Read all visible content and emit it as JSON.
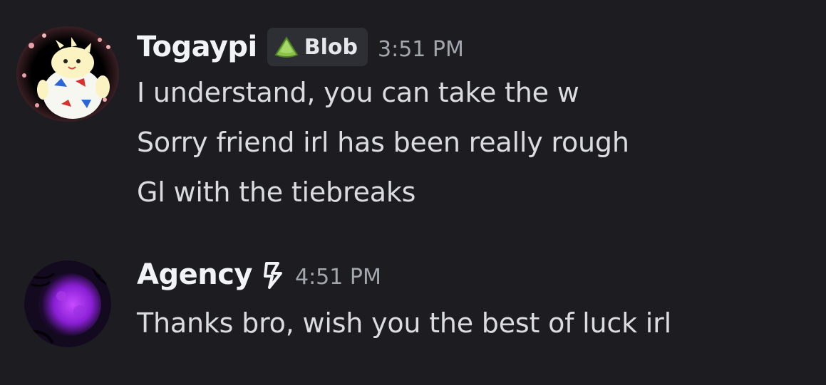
{
  "messages": [
    {
      "author": "Togaypi",
      "role_tag": {
        "label": "Blob",
        "icon": "green-slime-icon",
        "color": "#8bc34a"
      },
      "timestamp": "3:51 PM",
      "avatar": "togepi-avatar",
      "lines": [
        "I understand, you can take the w",
        "Sorry friend irl has been really rough",
        "Gl with the tiebreaks"
      ]
    },
    {
      "author": "Agency",
      "status_icon": "lightning-bolt-icon",
      "timestamp": "4:51 PM",
      "avatar": "purple-moon-avatar",
      "lines": [
        "Thanks bro, wish you the best of luck irl"
      ]
    }
  ],
  "colors": {
    "background": "#1c1c21",
    "username": "#f2f3f5",
    "message_text": "#dbdcdf",
    "timestamp": "#a3a6ad",
    "tag_background": "#2d2f35"
  }
}
